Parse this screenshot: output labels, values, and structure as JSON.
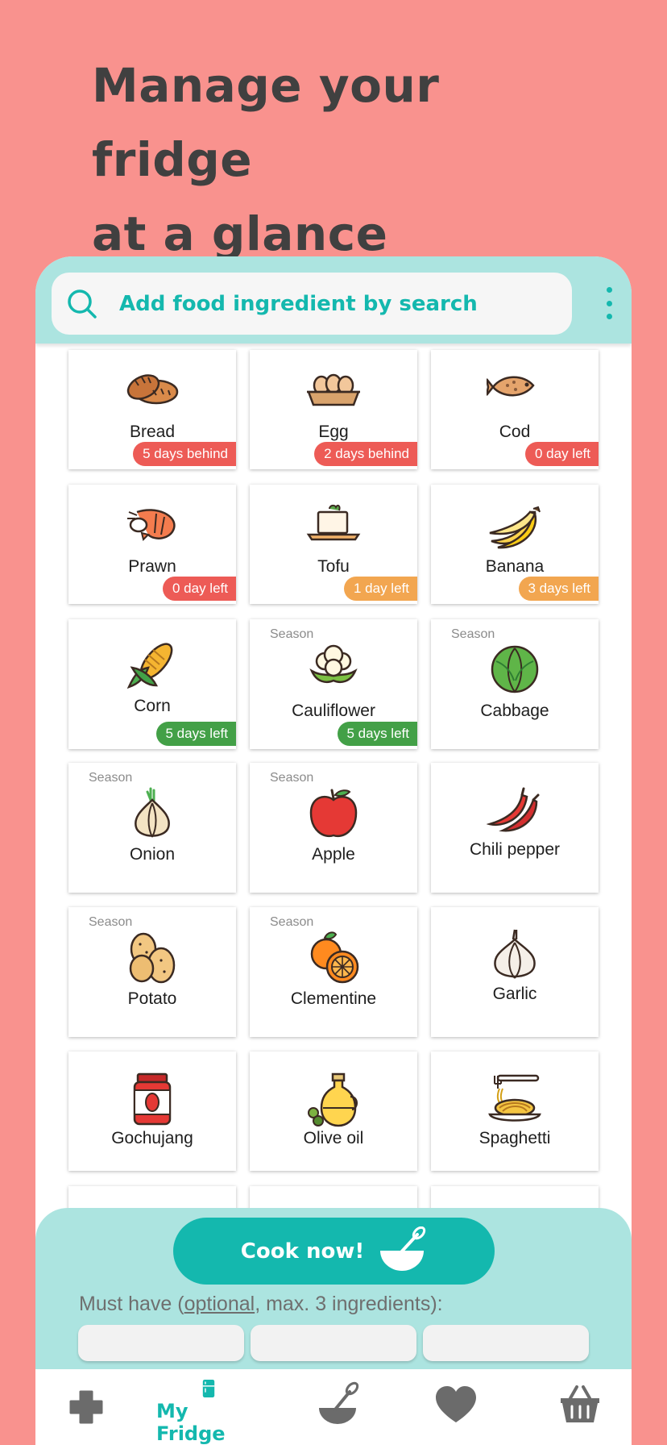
{
  "headline": {
    "line1": "Manage your fridge",
    "line2": "at a glance"
  },
  "search": {
    "placeholder": "Add food ingredient by search"
  },
  "colors": {
    "background": "#f9928e",
    "accent": "#14b8ae",
    "panel": "#ace4e0",
    "badge_red": "#ed5b56",
    "badge_orange": "#f2a650",
    "badge_green": "#43a047"
  },
  "items": [
    {
      "name": "Bread",
      "badge": "5 days behind",
      "status": "red",
      "season": "",
      "icon": "bread-icon"
    },
    {
      "name": "Egg",
      "badge": "2 days behind",
      "status": "red",
      "season": "",
      "icon": "egg-icon"
    },
    {
      "name": "Cod",
      "badge": "0 day left",
      "status": "red",
      "season": "",
      "icon": "fish-icon"
    },
    {
      "name": "Prawn",
      "badge": "0 day left",
      "status": "red",
      "season": "",
      "icon": "prawn-icon"
    },
    {
      "name": "Tofu",
      "badge": "1 day left",
      "status": "orange",
      "season": "",
      "icon": "tofu-icon"
    },
    {
      "name": "Banana",
      "badge": "3 days left",
      "status": "orange",
      "season": "",
      "icon": "banana-icon"
    },
    {
      "name": "Corn",
      "badge": "5 days left",
      "status": "green",
      "season": "",
      "icon": "corn-icon"
    },
    {
      "name": "Cauliflower",
      "badge": "5 days left",
      "status": "green",
      "season": "Season",
      "icon": "cauliflower-icon"
    },
    {
      "name": "Cabbage",
      "badge": "",
      "status": "",
      "season": "Season",
      "icon": "cabbage-icon"
    },
    {
      "name": "Onion",
      "badge": "",
      "status": "",
      "season": "Season",
      "icon": "onion-icon"
    },
    {
      "name": "Apple",
      "badge": "",
      "status": "",
      "season": "Season",
      "icon": "apple-icon"
    },
    {
      "name": "Chili pepper",
      "badge": "",
      "status": "",
      "season": "",
      "icon": "chili-icon"
    },
    {
      "name": "Potato",
      "badge": "",
      "status": "",
      "season": "Season",
      "icon": "potato-icon"
    },
    {
      "name": "Clementine",
      "badge": "",
      "status": "",
      "season": "Season",
      "icon": "clementine-icon"
    },
    {
      "name": "Garlic",
      "badge": "",
      "status": "",
      "season": "",
      "icon": "garlic-icon"
    },
    {
      "name": "Gochujang",
      "badge": "",
      "status": "",
      "season": "",
      "icon": "gochujang-icon"
    },
    {
      "name": "Olive oil",
      "badge": "",
      "status": "",
      "season": "",
      "icon": "olive-oil-icon"
    },
    {
      "name": "Spaghetti",
      "badge": "",
      "status": "",
      "season": "",
      "icon": "spaghetti-icon"
    }
  ],
  "cook": {
    "label": "Cook now!"
  },
  "must_have": {
    "prefix": "Must have (",
    "optional": "optional",
    "suffix": ", max. 3 ingredients):"
  },
  "nav": {
    "my_fridge": "My Fridge"
  }
}
